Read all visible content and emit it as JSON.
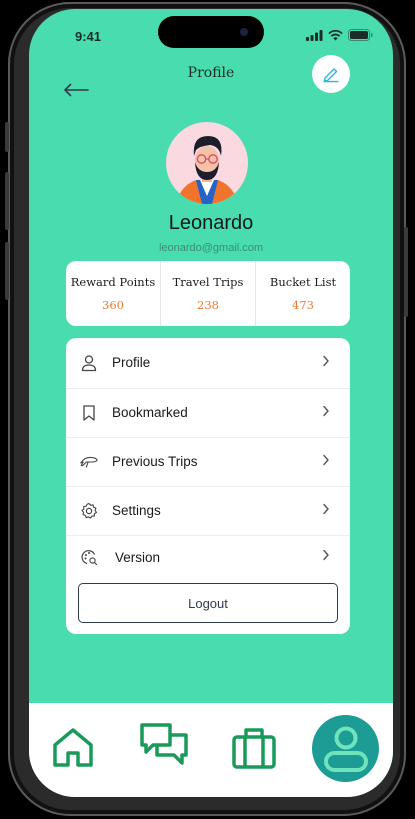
{
  "status_bar": {
    "time": "9:41"
  },
  "header": {
    "title": "Profile",
    "back_icon": "arrow-left-icon",
    "edit_icon": "pencil-icon"
  },
  "user": {
    "name": "Leonardo",
    "email": "leonardo@gmail.com"
  },
  "stats": [
    {
      "label": "Reward Points",
      "value": "360"
    },
    {
      "label": "Travel Trips",
      "value": "238"
    },
    {
      "label": "Bucket List",
      "value": "473"
    }
  ],
  "menu": {
    "items": [
      {
        "label": "Profile",
        "icon": "user-icon"
      },
      {
        "label": "Bookmarked",
        "icon": "bookmark-icon"
      },
      {
        "label": "Previous Trips",
        "icon": "plane-icon"
      },
      {
        "label": "Settings",
        "icon": "gear-icon"
      },
      {
        "label": "Version",
        "icon": "version-icon"
      }
    ],
    "logout_label": "Logout"
  },
  "bottom_nav": {
    "items": [
      "home-icon",
      "chat-icon",
      "briefcase-icon",
      "user-icon"
    ],
    "active": "user-icon"
  },
  "colors": {
    "background": "#48dcae",
    "accent_orange": "#ea7b38",
    "nav_green": "#1a9a5a",
    "nav_active": "#1c9c95"
  }
}
